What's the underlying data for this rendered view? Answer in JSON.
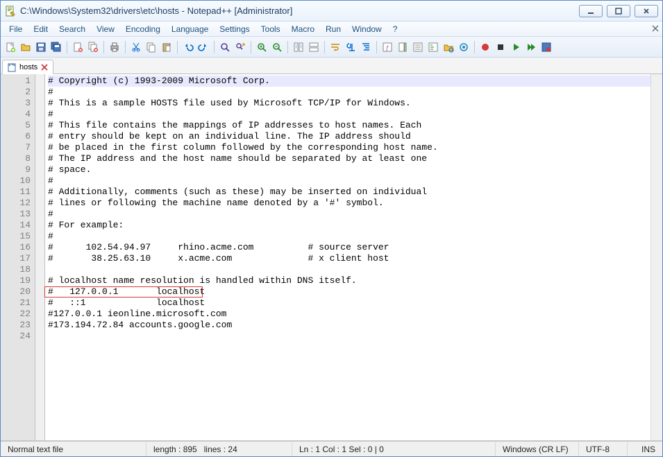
{
  "window": {
    "title": "C:\\Windows\\System32\\drivers\\etc\\hosts - Notepad++ [Administrator]"
  },
  "menu": [
    "File",
    "Edit",
    "Search",
    "View",
    "Encoding",
    "Language",
    "Settings",
    "Tools",
    "Macro",
    "Run",
    "Window",
    "?"
  ],
  "toolbar_icons": [
    "new-file-icon",
    "open-file-icon",
    "save-icon",
    "save-all-icon",
    "sep",
    "close-icon",
    "close-all-icon",
    "sep",
    "print-icon",
    "sep",
    "cut-icon",
    "copy-icon",
    "paste-icon",
    "sep",
    "undo-icon",
    "redo-icon",
    "sep",
    "find-icon",
    "replace-icon",
    "sep",
    "zoom-in-icon",
    "zoom-out-icon",
    "sep",
    "sync-v-icon",
    "sync-h-icon",
    "sep",
    "wordwrap-icon",
    "all-chars-icon",
    "indent-guide-icon",
    "sep",
    "lang-udl-icon",
    "doc-map-icon",
    "doc-list-icon",
    "func-list-icon",
    "folder-workspace-icon",
    "monitor-icon",
    "sep",
    "record-macro-icon",
    "stop-macro-icon",
    "play-macro-icon",
    "play-multi-icon",
    "save-macro-icon"
  ],
  "tab": {
    "filename": "hosts"
  },
  "code": {
    "current_line": 1,
    "highlight_line": 20,
    "lines": [
      "# Copyright (c) 1993-2009 Microsoft Corp.",
      "#",
      "# This is a sample HOSTS file used by Microsoft TCP/IP for Windows.",
      "#",
      "# This file contains the mappings of IP addresses to host names. Each",
      "# entry should be kept on an individual line. The IP address should",
      "# be placed in the first column followed by the corresponding host name.",
      "# The IP address and the host name should be separated by at least one",
      "# space.",
      "#",
      "# Additionally, comments (such as these) may be inserted on individual",
      "# lines or following the machine name denoted by a '#' symbol.",
      "#",
      "# For example:",
      "#",
      "#      102.54.94.97     rhino.acme.com          # source server",
      "#       38.25.63.10     x.acme.com              # x client host",
      "",
      "# localhost name resolution is handled within DNS itself.",
      "#   127.0.0.1       localhost",
      "#   ::1             localhost",
      "#127.0.0.1 ieonline.microsoft.com",
      "#173.194.72.84 accounts.google.com",
      ""
    ]
  },
  "status": {
    "filetype": "Normal text file",
    "length_label": "length : 895",
    "lines_label": "lines : 24",
    "pos_label": "Ln : 1   Col : 1   Sel : 0 | 0",
    "eol": "Windows (CR LF)",
    "encoding": "UTF-8",
    "insert_mode": "INS"
  }
}
